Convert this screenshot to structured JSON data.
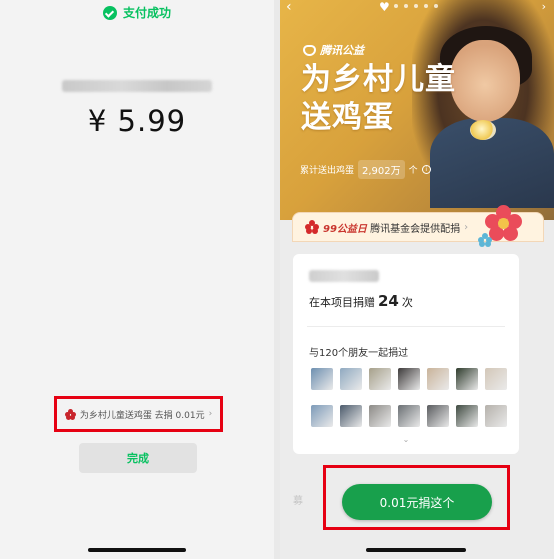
{
  "left": {
    "pay_status": "支付成功",
    "amount": "¥ 5.99",
    "donate_link": "为乡村儿童送鸡蛋 去捐 0.01元",
    "done_label": "完成",
    "icons": [
      "wechat-check-icon",
      "flower-icon",
      "chevron-right-icon"
    ]
  },
  "right": {
    "brand": "腾讯公益",
    "headline_line1": "为乡村儿童",
    "headline_line2": "送鸡蛋",
    "stat_label": "累计送出鸡蛋",
    "stat_value": "2,902万",
    "stat_unit": "个",
    "partner_tag": "99公益日",
    "partner_text": "腾讯基金会提供配捐",
    "donated_prefix": "在本项目捐赠",
    "donated_count": "24",
    "donated_unit": "次",
    "friends_label": "与120个朋友一起捐过",
    "donate_button": "0.01元捐这个",
    "ghost_text": "募",
    "avatar_colors": [
      "#6d8fb0",
      "#8fa9c0",
      "#a6a08a",
      "#3d3a3a",
      "#c9b39a",
      "#2e3b2c",
      "#d3c7b8",
      "#7c9ab8",
      "#4b5a6b",
      "#8c8a86",
      "#6a6f73",
      "#595b5e",
      "#3f4a41",
      "#b5b1ab"
    ],
    "icons": [
      "back-arrow-icon",
      "heart-icon",
      "share-icon",
      "info-icon",
      "flower-icon",
      "chevron-right-icon",
      "chevron-down-icon"
    ]
  },
  "colors": {
    "wechat_green": "#07c160",
    "donate_green": "#18a04c",
    "highlight_red": "#e60012",
    "banner_gold": "#d8a13c"
  }
}
